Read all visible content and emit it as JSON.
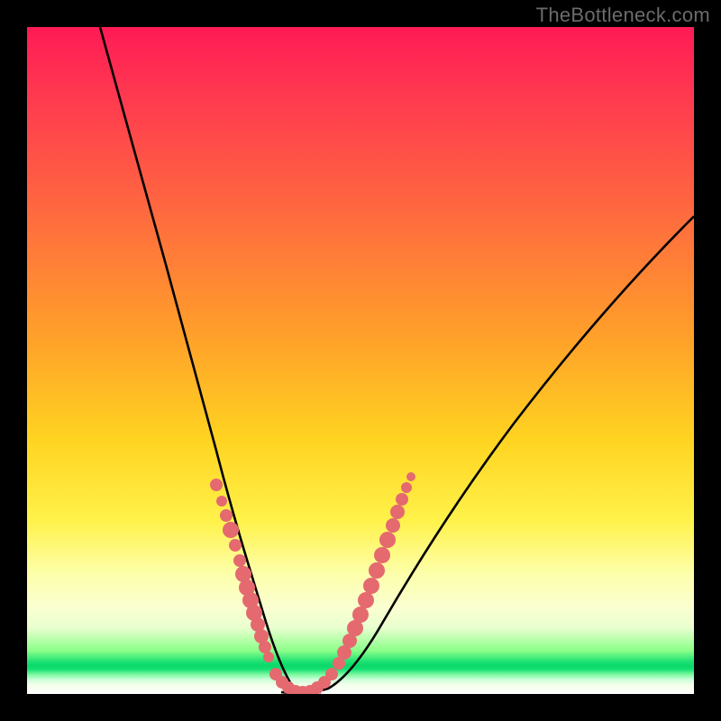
{
  "watermark": "TheBottleneck.com",
  "chart_data": {
    "type": "line",
    "title": "",
    "xlabel": "",
    "ylabel": "",
    "xlim": [
      0,
      100
    ],
    "ylim": [
      0,
      100
    ],
    "grid": false,
    "legend": false,
    "series": [
      {
        "name": "left-branch",
        "x": [
          11,
          14,
          17,
          20,
          23,
          25,
          27,
          29,
          30.5,
          31.8,
          33,
          34,
          35,
          35.8,
          36.5,
          37.2,
          38
        ],
        "y": [
          100,
          88,
          76,
          64,
          52,
          42,
          33,
          25,
          18,
          13,
          9,
          6,
          4,
          2.5,
          1.5,
          0.7,
          0.2
        ]
      },
      {
        "name": "valley-floor",
        "x": [
          38,
          39,
          40,
          41,
          42,
          43
        ],
        "y": [
          0.2,
          0.05,
          0,
          0,
          0.05,
          0.2
        ]
      },
      {
        "name": "right-branch",
        "x": [
          43,
          44,
          45,
          47,
          49,
          52,
          56,
          60,
          65,
          70,
          76,
          82,
          88,
          94,
          100
        ],
        "y": [
          0.2,
          0.9,
          2,
          5,
          9,
          15,
          23,
          31,
          40,
          48,
          56,
          63,
          69,
          74,
          78
        ]
      }
    ],
    "marker_regions": [
      {
        "name": "left-dots",
        "x": [
          27.5,
          28.3,
          29.0,
          29.6,
          30.2,
          30.8,
          31.3,
          31.8,
          32.3,
          32.8,
          33.3,
          33.8,
          34.3,
          34.8
        ],
        "y": [
          31,
          27.5,
          24,
          21,
          18.5,
          16,
          14,
          12,
          10.3,
          8.8,
          7.4,
          6.2,
          5.2,
          4.3
        ]
      },
      {
        "name": "floor-dots",
        "x": [
          36.2,
          37.0,
          37.8,
          38.6,
          39.4,
          40.2,
          41.0,
          41.8,
          42.6
        ],
        "y": [
          1.2,
          0.6,
          0.25,
          0.08,
          0.02,
          0.02,
          0.08,
          0.25,
          0.6
        ]
      },
      {
        "name": "right-dots",
        "x": [
          44.5,
          45.3,
          46.1,
          46.9,
          47.7,
          48.5,
          49.3,
          50.1,
          50.9,
          51.7,
          52.5,
          53.3,
          54.1,
          54.9,
          55.7
        ],
        "y": [
          2.6,
          4.0,
          5.8,
          7.8,
          10.0,
          12.4,
          15.0,
          17.6,
          20.2,
          22.8,
          25.2,
          27.5,
          29.6,
          31.5,
          33.2
        ]
      }
    ],
    "colors": {
      "curve": "#000000",
      "markers": "#e46a6f",
      "background_top": "#ff1a55",
      "background_mid": "#ffd421",
      "background_green": "#1be072",
      "frame": "#000000"
    }
  }
}
